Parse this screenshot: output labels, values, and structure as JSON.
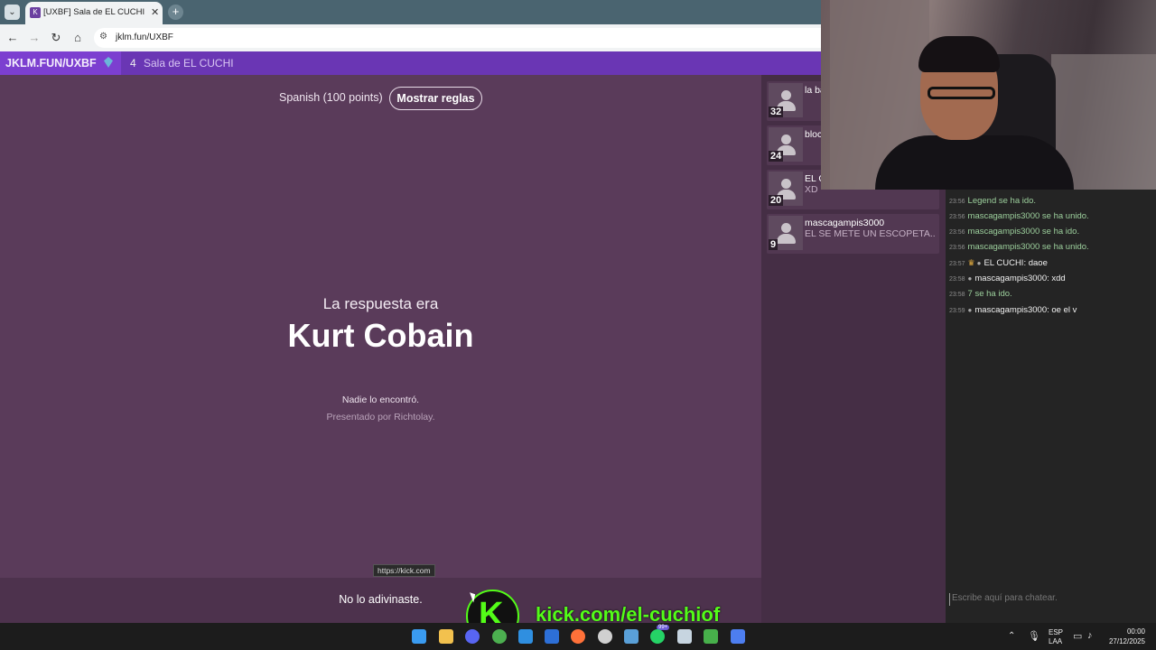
{
  "browser": {
    "tab_title": "[UXBF] Sala de EL CUCHI",
    "tab_favicon": "K",
    "tab_close": "✕",
    "new_tab": "+",
    "url": "jklm.fun/UXBF",
    "icons": [
      "back-icon",
      "forward-icon",
      "reload-icon",
      "home-icon",
      "site-settings-icon"
    ]
  },
  "room": {
    "code": "JKLM.FUN/UXBF",
    "player_count": "4",
    "name": "Sala de EL CUCHI"
  },
  "game": {
    "dictionary": "Spanish (100 points)",
    "rules_button": "Mostrar reglas",
    "answer_prefix": "La respuesta era",
    "answer": "Kurt Cobain",
    "nobody_found": "Nadie lo encontró.",
    "presented_by": "Presentado por Richtolay.",
    "result": "No lo adivinaste.",
    "link_tooltip": "https://kick.com"
  },
  "players": [
    {
      "score": "32",
      "name": "la ba",
      "message": ""
    },
    {
      "score": "24",
      "name": "bloc",
      "message": ""
    },
    {
      "score": "20",
      "name": "EL C",
      "message": "XD"
    },
    {
      "score": "9",
      "name": "mascagampis3000",
      "message": "EL SE METE UN ESCOPETA..."
    }
  ],
  "chat": {
    "messages": [
      {
        "time": "23:56",
        "text": "Legend se ha ido.",
        "type": "system"
      },
      {
        "time": "23:56",
        "text": "mascagampis3000 se ha unido.",
        "type": "system"
      },
      {
        "time": "23:56",
        "text": "mascagampis3000 se ha ido.",
        "type": "system"
      },
      {
        "time": "23:56",
        "text": "mascagampis3000 se ha unido.",
        "type": "system"
      },
      {
        "time": "23:57",
        "text": "EL CUCHI: daoe",
        "type": "owner"
      },
      {
        "time": "23:58",
        "text": "mascagampis3000: xdd",
        "type": "user"
      },
      {
        "time": "23:58",
        "text": "7  se ha ido.",
        "type": "system"
      },
      {
        "time": "23:59",
        "text": "mascagampis3000: oe el v",
        "type": "user"
      }
    ],
    "input_placeholder": "Escribe aquí para chatear."
  },
  "overlay": {
    "kick_letter": "K",
    "kick_url": "kick.com/el-cuchiof"
  },
  "taskbar": {
    "apps": [
      {
        "name": "windows-start-icon",
        "color": "#3a9bf0"
      },
      {
        "name": "file-explorer-icon",
        "color": "#f2c14e"
      },
      {
        "name": "discord-icon",
        "color": "#5865f2"
      },
      {
        "name": "chrome-icon",
        "color": "#4caf50"
      },
      {
        "name": "vscode-icon",
        "color": "#2f8fe0"
      },
      {
        "name": "virtualbox-icon",
        "color": "#2d6fd6"
      },
      {
        "name": "firefox-icon",
        "color": "#ff7139"
      },
      {
        "name": "obs-icon",
        "color": "#d0d0d0"
      },
      {
        "name": "ghost-icon",
        "color": "#5aa0d8"
      },
      {
        "name": "whatsapp-icon",
        "color": "#25d366"
      },
      {
        "name": "steam-icon",
        "color": "#c7d5e0"
      },
      {
        "name": "terminal-icon",
        "color": "#47b04b"
      },
      {
        "name": "diamond-app-icon",
        "color": "#4d7ef0"
      }
    ],
    "whatsapp_badge": "99+",
    "lang_top": "ESP",
    "lang_bottom": "LAA",
    "time": "00:00",
    "date": "27/12/2025"
  }
}
